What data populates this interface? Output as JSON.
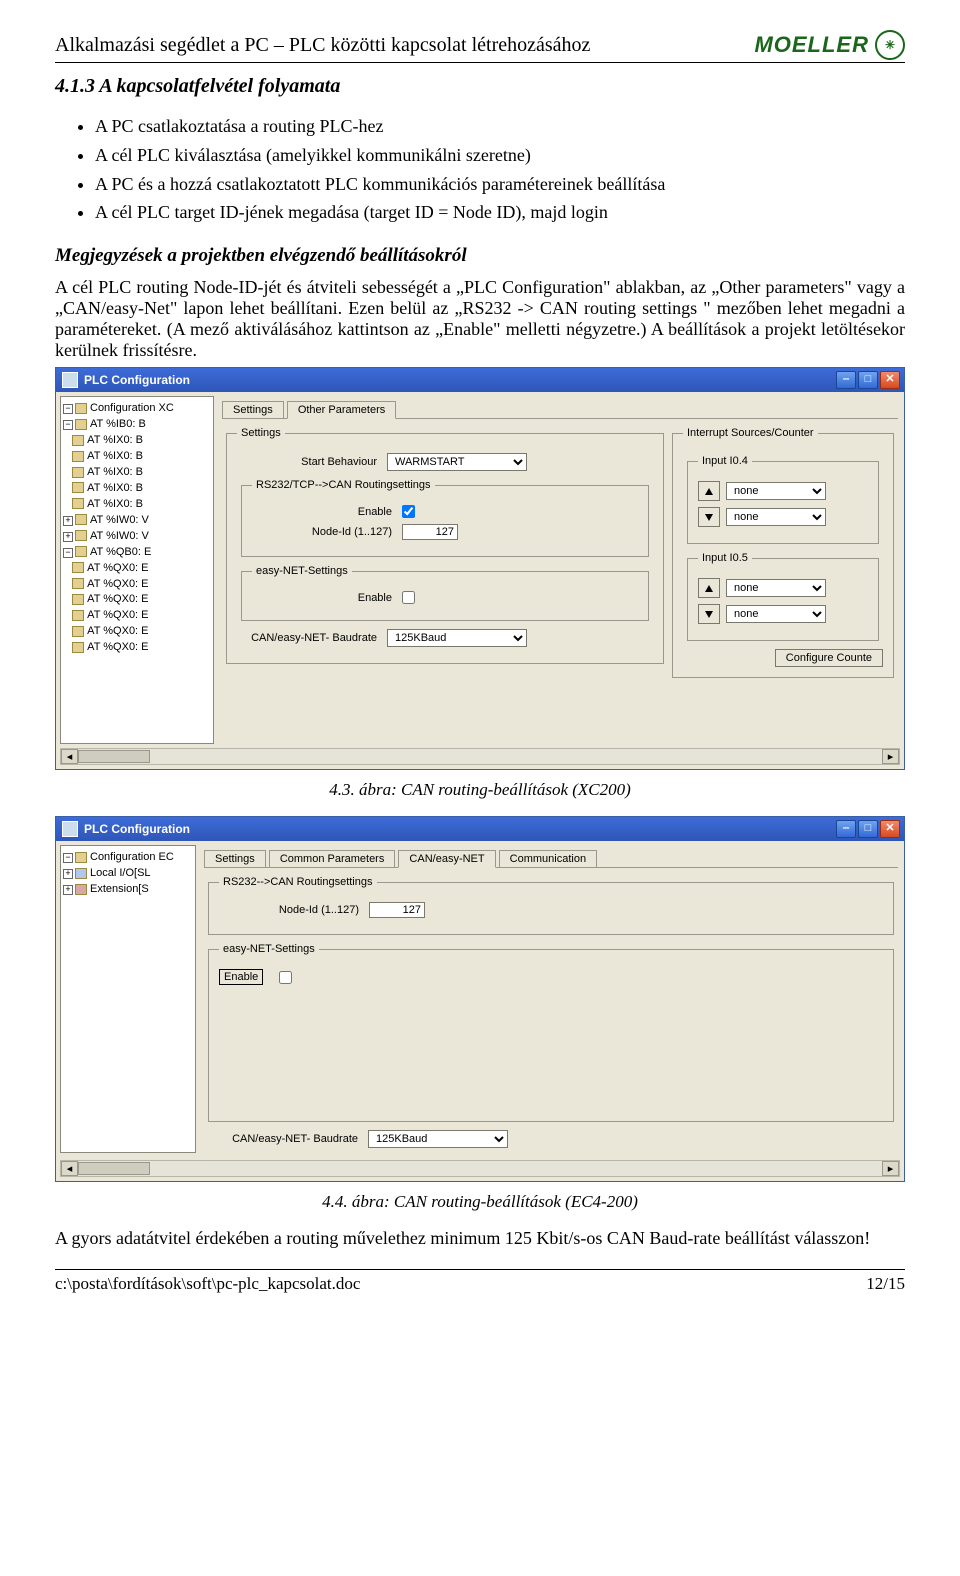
{
  "header": {
    "title": "Alkalmazási segédlet a PC – PLC közötti kapcsolat létrehozásához",
    "brand": "MOELLER"
  },
  "section": {
    "heading": "4.1.3 A kapcsolatfelvétel folyamata"
  },
  "bullets": [
    "A PC csatlakoztatása a routing PLC-hez",
    "A cél PLC kiválasztása (amelyikkel kommunikálni szeretne)",
    "A PC és a hozzá csatlakoztatott PLC kommunikációs paramétereinek beállítása",
    "A cél PLC target ID-jének megadása (target ID = Node ID), majd login"
  ],
  "notes_heading": "Megjegyzések a projektben elvégzendő beállításokról",
  "para1": "A cél PLC routing Node-ID-jét és átviteli sebességét a „PLC Configuration\" ablakban, az „Other parameters\" vagy a „CAN/easy-Net\" lapon lehet beállítani. Ezen belül az „RS232 -> CAN routing settings \" mezőben lehet megadni a paramétereket. (A mező aktiválásához kattintson az „Enable\" melletti négyzetre.) A beállítások a projekt letöltésekor kerülnek frissítésre.",
  "fig1": {
    "title": "PLC Configuration",
    "tree_root": "Configuration XC",
    "tree_items": [
      "AT %IB0: B",
      "AT %IX0: B",
      "AT %IX0: B",
      "AT %IX0: B",
      "AT %IX0: B",
      "AT %IX0: B",
      "AT %IW0: V",
      "AT %IW0: V",
      "AT %QB0: E",
      "AT %QX0: E",
      "AT %QX0: E",
      "AT %QX0: E",
      "AT %QX0: E",
      "AT %QX0: E",
      "AT %QX0: E"
    ],
    "tabs": [
      "Settings",
      "Other Parameters"
    ],
    "active_tab": 1,
    "settings_group": "Settings",
    "start_behaviour_label": "Start Behaviour",
    "start_behaviour_value": "WARMSTART",
    "rs232_group": "RS232/TCP-->CAN Routingsettings",
    "enable_label": "Enable",
    "enable_checked": true,
    "nodeid_label": "Node-Id (1..127)",
    "nodeid_value": "127",
    "easy_group": "easy-NET-Settings",
    "easy_enable_checked": false,
    "baud_label": "CAN/easy-NET- Baudrate",
    "baud_value": "125KBaud",
    "interrupt_group": "Interrupt Sources/Counter",
    "input04": "Input I0.4",
    "input05": "Input I0.5",
    "none": "none",
    "config_btn": "Configure Counte"
  },
  "caption1": "4.3. ábra: CAN routing-beállítások (XC200)",
  "fig2": {
    "title": "PLC Configuration",
    "tree_root": "Configuration EC",
    "tree_items": [
      "Local I/O[SL",
      "Extension[S"
    ],
    "tabs": [
      "Settings",
      "Common Parameters",
      "CAN/easy-NET",
      "Communication"
    ],
    "active_tab": 2,
    "rs232_group": "RS232-->CAN Routingsettings",
    "nodeid_label": "Node-Id (1..127)",
    "nodeid_value": "127",
    "easy_group": "easy-NET-Settings",
    "enable_label": "Enable",
    "easy_enable_checked": false,
    "baud_label": "CAN/easy-NET- Baudrate",
    "baud_value": "125KBaud"
  },
  "caption2": "4.4. ábra: CAN routing-beállítások (EC4-200)",
  "para2": "A gyors adatátvitel érdekében a routing művelethez minimum 125 Kbit/s-os CAN Baud-rate beállítást válasszon!",
  "footer": {
    "path": "c:\\posta\\fordítások\\soft\\pc-plc_kapcsolat.doc",
    "page": "12/15"
  }
}
